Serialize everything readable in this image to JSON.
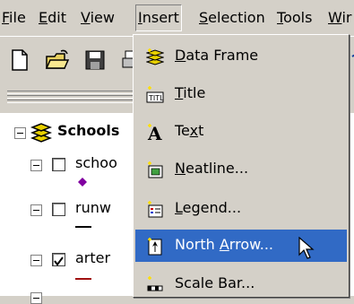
{
  "menubar": {
    "items": [
      {
        "label": "File",
        "mnemonic": "F",
        "rest": "ile"
      },
      {
        "label": "Edit",
        "mnemonic": "E",
        "rest": "dit"
      },
      {
        "label": "View",
        "mnemonic": "V",
        "rest": "iew"
      },
      {
        "label": "Insert",
        "mnemonic": "I",
        "rest": "nsert"
      },
      {
        "label": "Selection",
        "mnemonic": "S",
        "rest": "election"
      },
      {
        "label": "Tools",
        "mnemonic": "T",
        "rest": "ools"
      },
      {
        "label": "Wir",
        "mnemonic": "W",
        "rest": "ir"
      }
    ]
  },
  "toc": {
    "dataframe": "Schools",
    "layers": [
      {
        "label": "schoo",
        "checked": false
      },
      {
        "label": "runw",
        "checked": false
      },
      {
        "label": "arter",
        "checked": true
      }
    ]
  },
  "insert_menu": {
    "items": [
      {
        "pre": "",
        "mn": "D",
        "post": "ata Frame",
        "icon": "data-frame-icon"
      },
      {
        "pre": "",
        "mn": "T",
        "post": "itle",
        "icon": "title-icon"
      },
      {
        "pre": "Te",
        "mn": "x",
        "post": "t",
        "icon": "text-icon"
      },
      {
        "pre": "",
        "mn": "N",
        "post": "eatline...",
        "icon": "neatline-icon"
      },
      {
        "pre": "",
        "mn": "L",
        "post": "egend...",
        "icon": "legend-icon"
      },
      {
        "pre": "North ",
        "mn": "A",
        "post": "rrow...",
        "icon": "north-arrow-icon",
        "highlighted": true
      },
      {
        "pre": "Scale Bar...",
        "mn": "",
        "post": "",
        "icon": "scale-bar-icon"
      }
    ]
  },
  "colors": {
    "highlight": "#316ac5",
    "face": "#d4d0c8"
  }
}
